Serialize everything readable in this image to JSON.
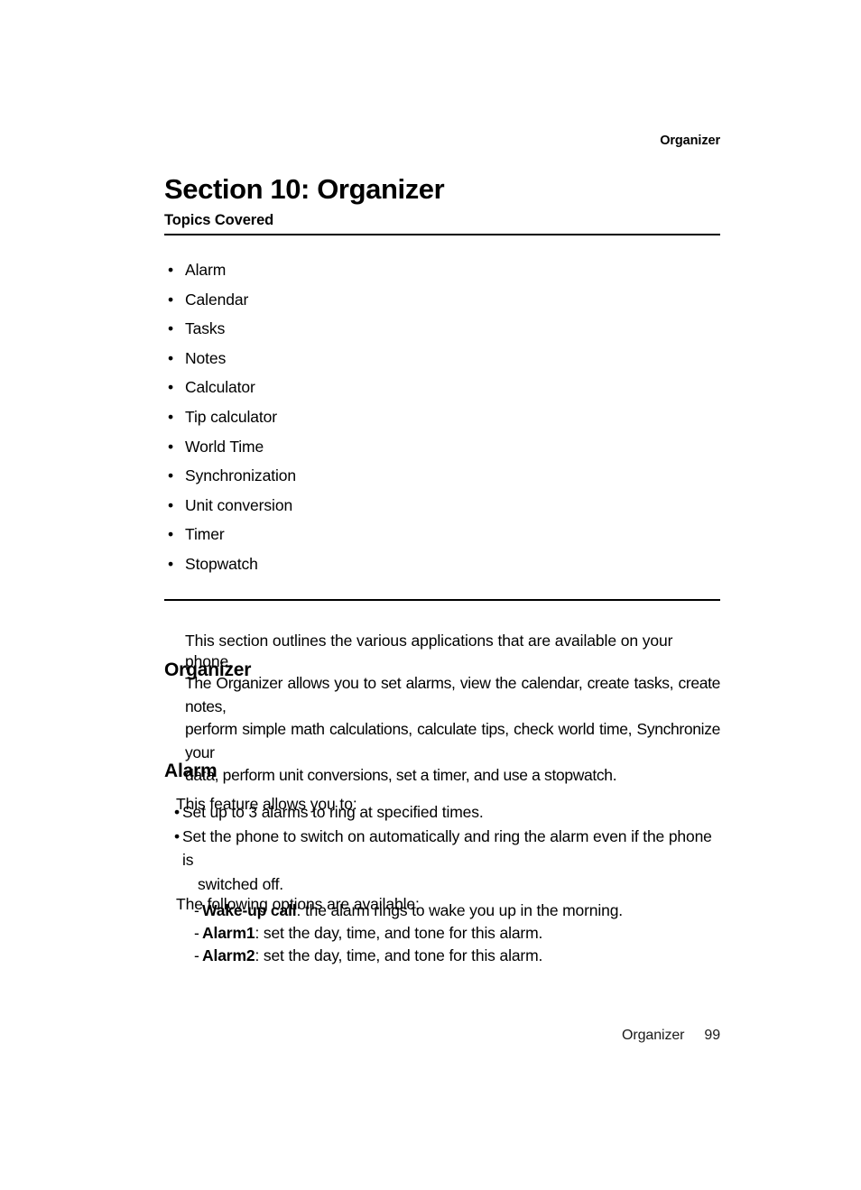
{
  "running_head": "Organizer",
  "section_title": "Section 10: Organizer",
  "topics": {
    "label": "Topics Covered",
    "bullet_glyph": "•",
    "items": [
      "Alarm",
      "Calendar",
      "Tasks",
      "Notes",
      "Calculator",
      "Tip calculator",
      "World Time",
      "Synchronization",
      "Unit conversion",
      "Timer",
      "Stopwatch"
    ]
  },
  "intro": "This section outlines the various applications that are available on your phone.",
  "organizer": {
    "heading": "Organizer",
    "paragraph_lines": [
      "The Organizer allows you to set alarms, view the calendar, create tasks, create notes,",
      "perform simple math calculations, calculate tips, check world time, Synchronize your",
      "data, perform unit conversions, set a timer, and use a stopwatch."
    ]
  },
  "alarm": {
    "heading": "Alarm",
    "intro": "This feature allows you to:",
    "bullet_glyph": "•",
    "features": [
      {
        "line1": "Set up to 3 alarms to ring at specified times.",
        "line2": ""
      },
      {
        "line1": "Set the phone to switch on automatically and ring the alarm even if the phone is",
        "line2": "switched off."
      }
    ],
    "options_intro": "The following options are available:",
    "dash_glyph": "-",
    "options": [
      {
        "term": "Wake-up call",
        "description": ": the alarm rings to wake you up in the morning."
      },
      {
        "term": "Alarm1",
        "description": ": set the day, time, and tone for this alarm."
      },
      {
        "term": "Alarm2",
        "description": ": set the day, time, and tone for this alarm."
      }
    ]
  },
  "footer": {
    "label": "Organizer",
    "page_number": "99"
  }
}
